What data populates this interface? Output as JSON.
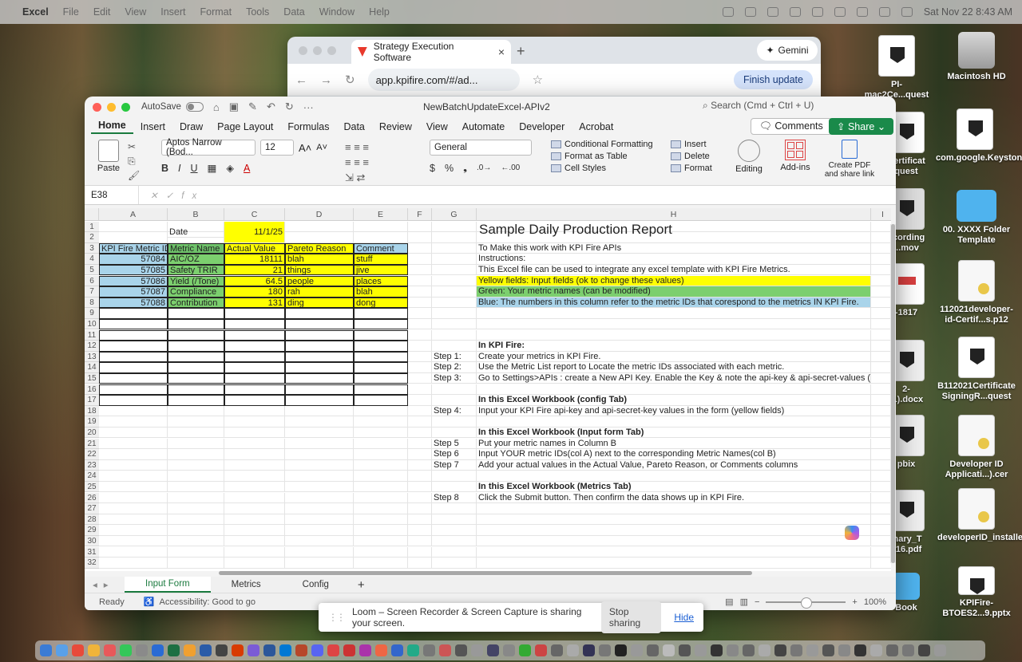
{
  "menubar": {
    "app": "Excel",
    "items": [
      "File",
      "Edit",
      "View",
      "Insert",
      "Format",
      "Tools",
      "Data",
      "Window",
      "Help"
    ],
    "clock": "Sat Nov 22  8:43 AM"
  },
  "chrome": {
    "tab_title": "Strategy Execution Software",
    "url": "app.kpifire.com/#/ad...",
    "gemini": "Gemini",
    "finish_update": "Finish update"
  },
  "desktop": {
    "icons": [
      {
        "label": "PI-\nmac2Ce...quest"
      },
      {
        "label": "Macintosh HD"
      },
      {
        "label": "Certificat\nquest"
      },
      {
        "label": "com.google.Keystone.plist"
      },
      {
        "label": "ecording\n...mov"
      },
      {
        "label": "00. XXXX Folder\nTemplate"
      },
      {
        "label": "-1817"
      },
      {
        "label": "112021developer-id-Certif...s.p12"
      },
      {
        "label": "2-\n(1).docx"
      },
      {
        "label": "B112021Certificate\nSigningR...quest"
      },
      {
        "label": "pbix"
      },
      {
        "label": "Developer ID\nApplicati...).cer"
      },
      {
        "label": "mary_T\n016.pdf"
      },
      {
        "label": "developerID_installer.cer"
      },
      {
        "label": "Book"
      },
      {
        "label": "KPIFire-\nBTOES2...9.pptx"
      }
    ]
  },
  "excel": {
    "autosave": "AutoSave",
    "doc_title": "NewBatchUpdateExcel-APIv2",
    "search_placeholder": "Search (Cmd + Ctrl + U)",
    "tabs": [
      "Home",
      "Insert",
      "Draw",
      "Page Layout",
      "Formulas",
      "Data",
      "Review",
      "View",
      "Automate",
      "Developer",
      "Acrobat"
    ],
    "comments": "Comments",
    "share": "Share",
    "ribbon": {
      "paste": "Paste",
      "font": "Aptos Narrow (Bod...",
      "size": "12",
      "number_format": "General",
      "conditional_formatting": "Conditional Formatting",
      "format_as_table": "Format as Table",
      "cell_styles": "Cell Styles",
      "insert": "Insert",
      "delete": "Delete",
      "format": "Format",
      "editing": "Editing",
      "addins": "Add-ins",
      "create_pdf": "Create PDF\nand share link"
    },
    "namebox": "E38",
    "columns": [
      "A",
      "B",
      "C",
      "D",
      "E",
      "F",
      "G",
      "H",
      "I"
    ],
    "rows": [
      "1",
      "2",
      "3",
      "4",
      "5",
      "6",
      "7",
      "8",
      "9",
      "10",
      "11",
      "12",
      "13",
      "14",
      "15",
      "16",
      "17",
      "18",
      "19",
      "20",
      "21",
      "22",
      "23",
      "24",
      "25",
      "26",
      "27",
      "28",
      "29",
      "30",
      "31",
      "32"
    ],
    "date_label": "Date",
    "date_value": "11/1/25",
    "table_headers": [
      "KPI Fire Metric ID",
      "Metric Name",
      "Actual Value",
      "Pareto Reason",
      "Comment"
    ],
    "table_rows": [
      [
        "57084",
        "AIC/OZ",
        "18111",
        "blah",
        "stuff"
      ],
      [
        "57085",
        "Safety TRIR",
        "21",
        "things",
        "jive"
      ],
      [
        "57086",
        "Yield (/Tone)",
        "64.5",
        "people",
        "places"
      ],
      [
        "57087",
        "Compliance",
        "180",
        "rah",
        "blah"
      ],
      [
        "57088",
        "Contribution",
        "131",
        "ding",
        "dong"
      ]
    ],
    "report_title": "Sample Daily Production Report",
    "instructions": {
      "r3": "To Make this work with KPI Fire APIs",
      "r4": "Instructions:",
      "r5": "This Excel file can be used to integrate any excel template with KPI Fire Metrics.",
      "r6": "Yellow fields: Input fields (ok to change these values)",
      "r7": "Green:  Your metric names (can be modified)",
      "r8": "Blue: The numbers in this column refer to the metric IDs that corespond to the metrics IN KPI Fire.",
      "r12": "In KPI Fire:",
      "r13_step": "Step 1:",
      "r13": "Create your metrics in KPI Fire.",
      "r14_step": "Step 2:",
      "r14": "Use the Metric List report to Locate the metric IDs associated with each metric.",
      "r15_step": "Step 3:",
      "r15": "Go to Settings>APIs : create a New API Key. Enable the Key &  note the api-key & api-secret-values (use in step",
      "r17": "In this Excel Workbook (config Tab)",
      "r18_step": "Step 4:",
      "r18": "Input your KPI Fire api-key and api-secret-key values in the form (yellow fields)",
      "r20": "In this Excel Workbook (Input form Tab)",
      "r21_step": "Step 5",
      "r21": "Put your metric names in Column B",
      "r22_step": "Step 6",
      "r22": "Input YOUR metric IDs(col A)  next to the corresponding Metric Names(col B)",
      "r23_step": "Step 7",
      "r23": "Add your actual values in the Actual Value, Pareto Reason, or Comments columns",
      "r25": "In this Excel Workbook (Metrics Tab)",
      "r26_step": "Step 8",
      "r26": "Click the Submit button. Then confirm the data shows up in KPI Fire."
    },
    "sheet_tabs": [
      "Input Form",
      "Metrics",
      "Config"
    ],
    "status_ready": "Ready",
    "status_accessibility": "Accessibility: Good to go",
    "zoom": "100%"
  },
  "loom": {
    "message": "Loom – Screen Recorder & Screen Capture is sharing your screen.",
    "stop": "Stop sharing",
    "hide": "Hide"
  },
  "colors": {
    "excel_green": "#1a7a3e",
    "blue_cell": "#a9d4ea",
    "green_cell": "#6ec26a",
    "yellow_cell": "#ffff00"
  }
}
